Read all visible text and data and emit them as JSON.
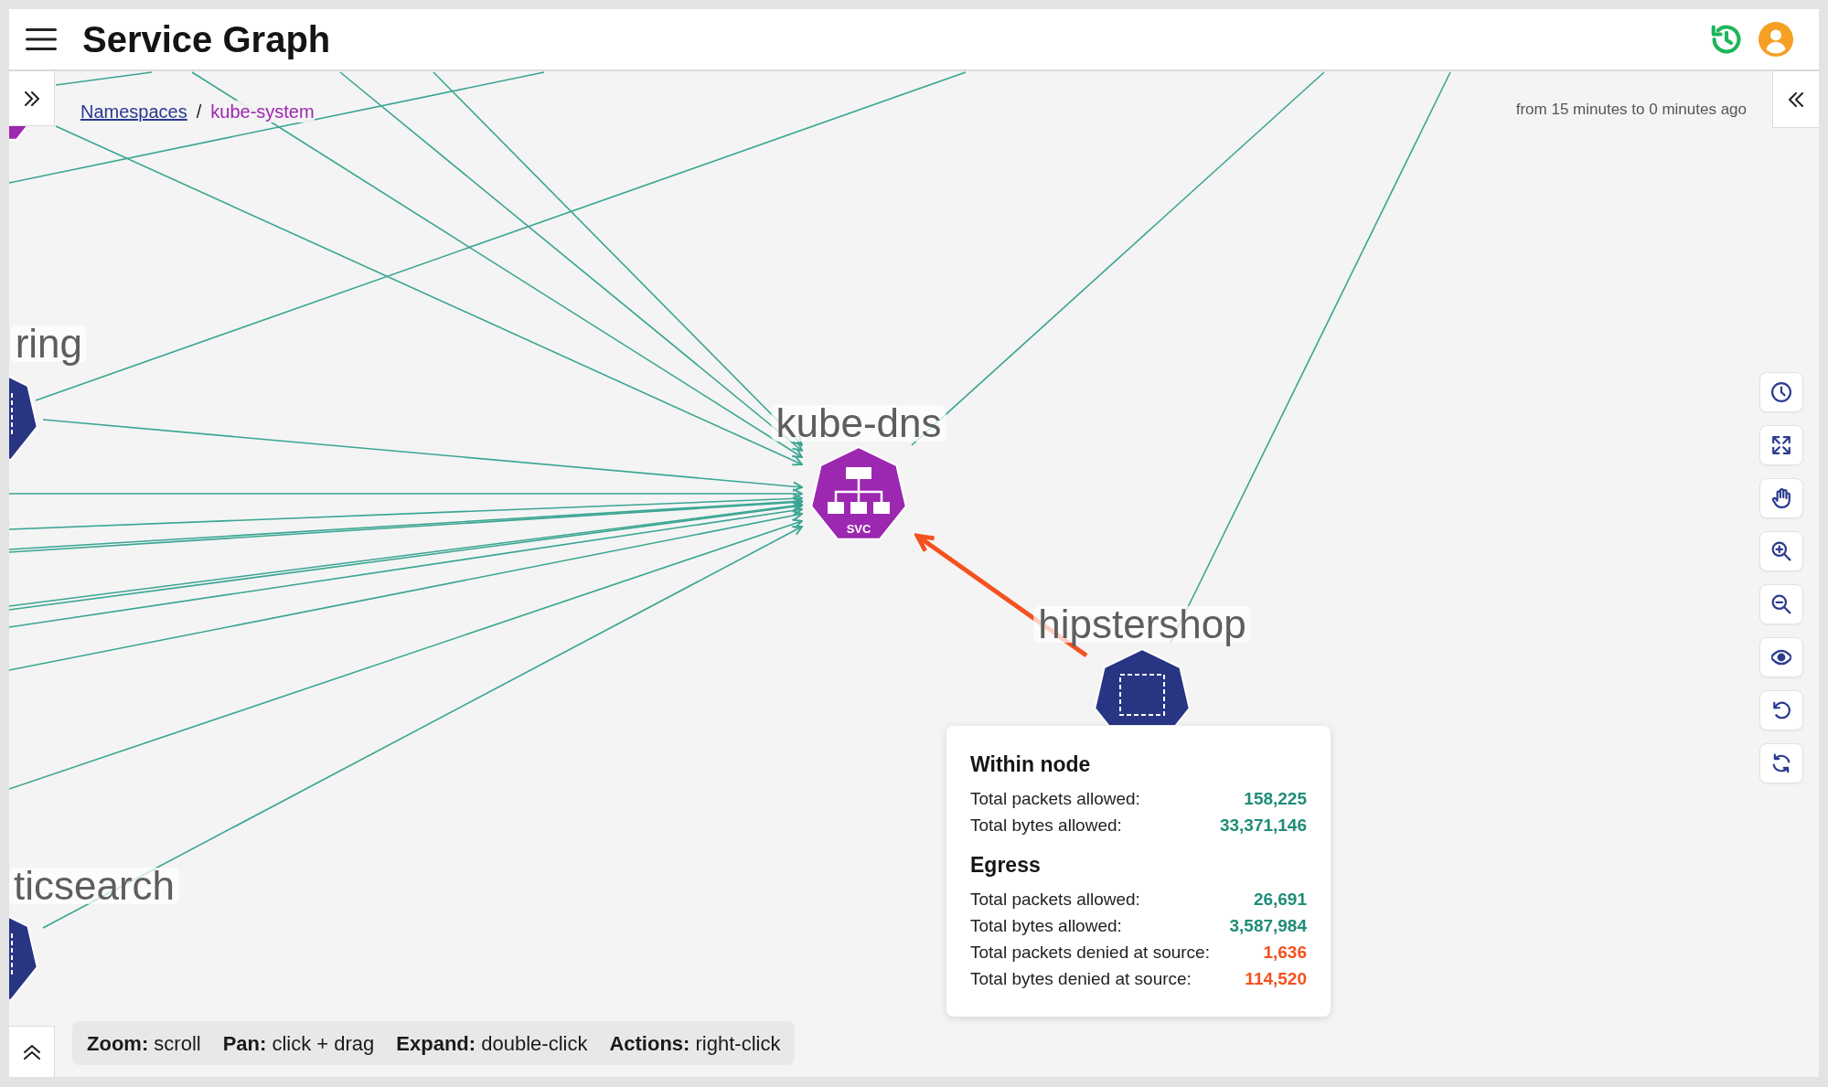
{
  "header": {
    "title": "Service Graph"
  },
  "breadcrumb": {
    "items": [
      {
        "label": "Namespaces",
        "kind": "link"
      },
      {
        "label": "kube-system",
        "kind": "current"
      }
    ],
    "separator": "/"
  },
  "time_range": "from 15 minutes to 0 minutes ago",
  "graph": {
    "nodes": [
      {
        "kind": "service",
        "label": "kube-dns",
        "badge": "SVC"
      },
      {
        "kind": "namespace",
        "label": "hipstershop"
      },
      {
        "kind": "namespace",
        "label": "ring"
      },
      {
        "kind": "namespace",
        "label": "ticsearch"
      },
      {
        "kind": "service"
      }
    ]
  },
  "tooltip": {
    "sections": [
      {
        "title": "Within node",
        "rows": [
          {
            "label": "Total packets allowed:",
            "value": "158,225",
            "kind": "allowed"
          },
          {
            "label": "Total bytes allowed:",
            "value": "33,371,146",
            "kind": "allowed"
          }
        ]
      },
      {
        "title": "Egress",
        "rows": [
          {
            "label": "Total packets allowed:",
            "value": "26,691",
            "kind": "allowed"
          },
          {
            "label": "Total bytes allowed:",
            "value": "3,587,984",
            "kind": "allowed"
          },
          {
            "label": "Total packets denied at source:",
            "value": "1,636",
            "kind": "denied"
          },
          {
            "label": "Total bytes denied at source:",
            "value": "114,520",
            "kind": "denied"
          }
        ]
      }
    ]
  },
  "hints": [
    {
      "key": "Zoom:",
      "action": "scroll"
    },
    {
      "key": "Pan:",
      "action": "click + drag"
    },
    {
      "key": "Expand:",
      "action": "double-click"
    },
    {
      "key": "Actions:",
      "action": "right-click"
    }
  ]
}
